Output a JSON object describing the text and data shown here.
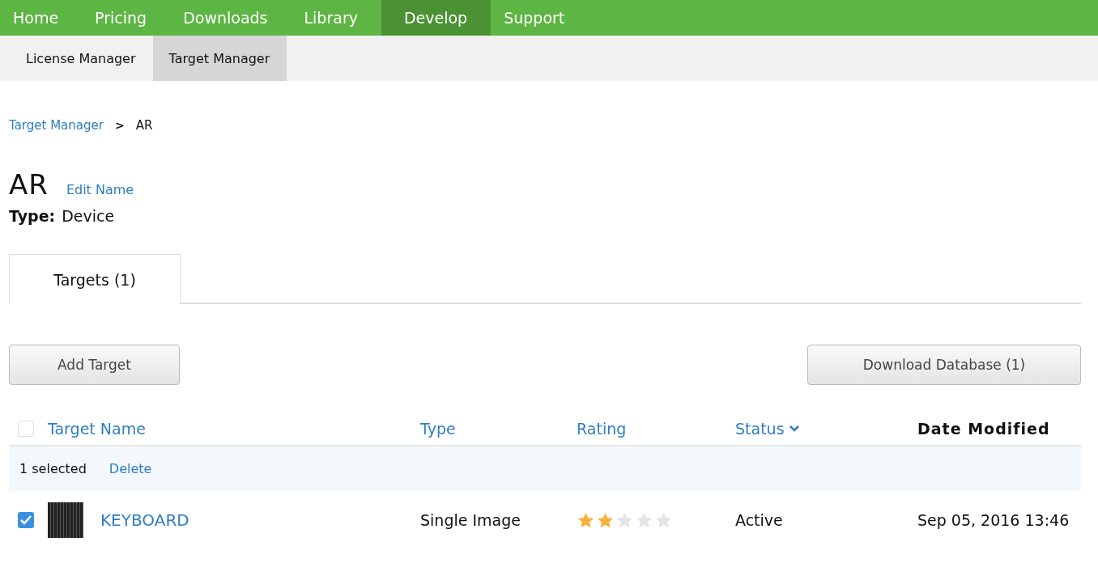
{
  "top_nav": [
    {
      "label": "Home",
      "selected": false
    },
    {
      "label": "Pricing",
      "selected": false
    },
    {
      "label": "Downloads",
      "selected": false
    },
    {
      "label": "Library",
      "selected": false
    },
    {
      "label": "Develop",
      "selected": true
    },
    {
      "label": "Support",
      "selected": false
    }
  ],
  "sub_nav": [
    {
      "label": "License Manager",
      "selected": false
    },
    {
      "label": "Target Manager",
      "selected": true
    }
  ],
  "breadcrumb": {
    "link": "Target Manager",
    "separator": ">",
    "current": "AR"
  },
  "database": {
    "name": "AR",
    "edit_link": "Edit Name",
    "type_label": "Type:",
    "type_value": "Device"
  },
  "tabs": [
    {
      "label": "Targets (1)",
      "selected": true
    }
  ],
  "buttons": {
    "add": "Add Target",
    "download": "Download Database (1)"
  },
  "table": {
    "select_all_checked": false,
    "columns": [
      {
        "label": "Target Name",
        "kind": "link"
      },
      {
        "label": "Type",
        "kind": "link"
      },
      {
        "label": "Rating",
        "kind": "link"
      },
      {
        "label": "Status",
        "kind": "sort"
      },
      {
        "label": "Date Modified",
        "kind": "plain"
      }
    ],
    "selection_bar": {
      "count": "1 selected",
      "action": "Delete"
    },
    "rows": [
      {
        "checked": true,
        "name": "KEYBOARD",
        "type": "Single Image",
        "stars": 2,
        "status": "Active",
        "date": "Sep 05, 2016 13:46"
      }
    ]
  }
}
